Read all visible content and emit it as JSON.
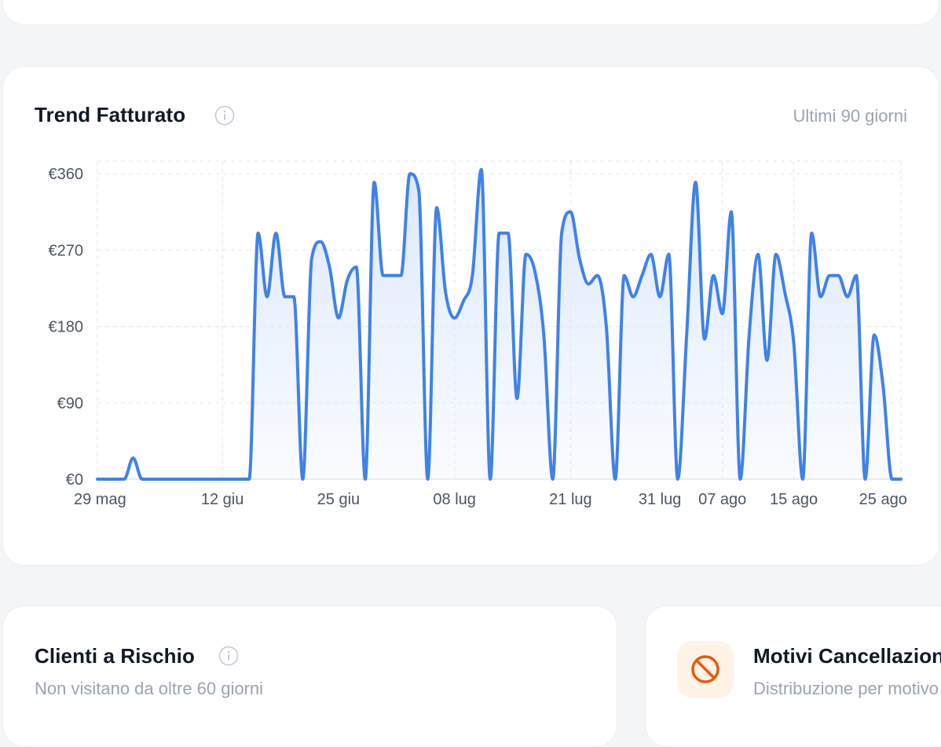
{
  "trend": {
    "title": "Trend Fatturato",
    "range_label": "Ultimi 90 giorni"
  },
  "risk": {
    "title": "Clienti a Rischio",
    "subtitle": "Non visitano da oltre 60 giorni"
  },
  "cancellations": {
    "title": "Motivi Cancellazioni",
    "subtitle": "Distribuzione per motivo"
  },
  "icons": {
    "info": "info-icon",
    "cancel": "ban-icon"
  },
  "colors": {
    "line": "#3f82e8",
    "area_top": "#dbe8fb",
    "grid": "#e5e9f0",
    "cancel_icon": "#ea580c",
    "cancel_badge": "#fff3e6"
  },
  "chart_data": {
    "type": "area",
    "title": "Trend Fatturato",
    "xlabel": "",
    "ylabel": "",
    "ylim": [
      0,
      375
    ],
    "xlim": [
      "2024-05-29",
      "2024-08-27"
    ],
    "y_ticks": [
      0,
      90,
      180,
      270,
      360
    ],
    "y_tick_labels": [
      "€0",
      "€90",
      "€180",
      "€270",
      "€360"
    ],
    "x_ticks": [
      "2024-05-29",
      "2024-06-12",
      "2024-06-25",
      "2024-07-08",
      "2024-07-21",
      "2024-07-31",
      "2024-08-07",
      "2024-08-15",
      "2024-08-25"
    ],
    "x_tick_labels": [
      "29 mag",
      "12 giu",
      "25 giu",
      "08 lug",
      "21 lug",
      "31 lug",
      "07 ago",
      "15 ago",
      "25 ago"
    ],
    "grid": true,
    "x": [
      "2024-05-29",
      "2024-05-30",
      "2024-05-31",
      "2024-06-01",
      "2024-06-02",
      "2024-06-03",
      "2024-06-04",
      "2024-06-05",
      "2024-06-06",
      "2024-06-07",
      "2024-06-08",
      "2024-06-09",
      "2024-06-10",
      "2024-06-11",
      "2024-06-12",
      "2024-06-13",
      "2024-06-14",
      "2024-06-15",
      "2024-06-16",
      "2024-06-17",
      "2024-06-18",
      "2024-06-19",
      "2024-06-20",
      "2024-06-21",
      "2024-06-22",
      "2024-06-23",
      "2024-06-24",
      "2024-06-25",
      "2024-06-26",
      "2024-06-27",
      "2024-06-28",
      "2024-06-29",
      "2024-06-30",
      "2024-07-01",
      "2024-07-02",
      "2024-07-03",
      "2024-07-04",
      "2024-07-05",
      "2024-07-06",
      "2024-07-07",
      "2024-07-08",
      "2024-07-09",
      "2024-07-10",
      "2024-07-11",
      "2024-07-12",
      "2024-07-13",
      "2024-07-14",
      "2024-07-15",
      "2024-07-16",
      "2024-07-17",
      "2024-07-18",
      "2024-07-19",
      "2024-07-20",
      "2024-07-21",
      "2024-07-22",
      "2024-07-23",
      "2024-07-24",
      "2024-07-25",
      "2024-07-26",
      "2024-07-27",
      "2024-07-28",
      "2024-07-29",
      "2024-07-30",
      "2024-07-31",
      "2024-08-01",
      "2024-08-02",
      "2024-08-03",
      "2024-08-04",
      "2024-08-05",
      "2024-08-06",
      "2024-08-07",
      "2024-08-08",
      "2024-08-09",
      "2024-08-10",
      "2024-08-11",
      "2024-08-12",
      "2024-08-13",
      "2024-08-14",
      "2024-08-15",
      "2024-08-16",
      "2024-08-17",
      "2024-08-18",
      "2024-08-19",
      "2024-08-20",
      "2024-08-21",
      "2024-08-22",
      "2024-08-23",
      "2024-08-24",
      "2024-08-25",
      "2024-08-26",
      "2024-08-27"
    ],
    "series": [
      {
        "values": [
          0,
          0,
          0,
          0,
          25,
          0,
          0,
          0,
          0,
          0,
          0,
          0,
          0,
          0,
          0,
          0,
          0,
          0,
          290,
          215,
          290,
          215,
          215,
          0,
          260,
          280,
          250,
          190,
          235,
          250,
          0,
          350,
          240,
          240,
          240,
          360,
          340,
          0,
          320,
          220,
          190,
          210,
          240,
          365,
          0,
          290,
          290,
          95,
          265,
          245,
          170,
          0,
          290,
          315,
          260,
          230,
          240,
          180,
          0,
          240,
          215,
          240,
          265,
          215,
          265,
          0,
          170,
          350,
          165,
          240,
          195,
          315,
          0,
          170,
          265,
          140,
          265,
          220,
          160,
          0,
          290,
          215,
          240,
          240,
          215,
          240,
          0,
          170,
          110,
          0,
          0
        ]
      }
    ]
  }
}
